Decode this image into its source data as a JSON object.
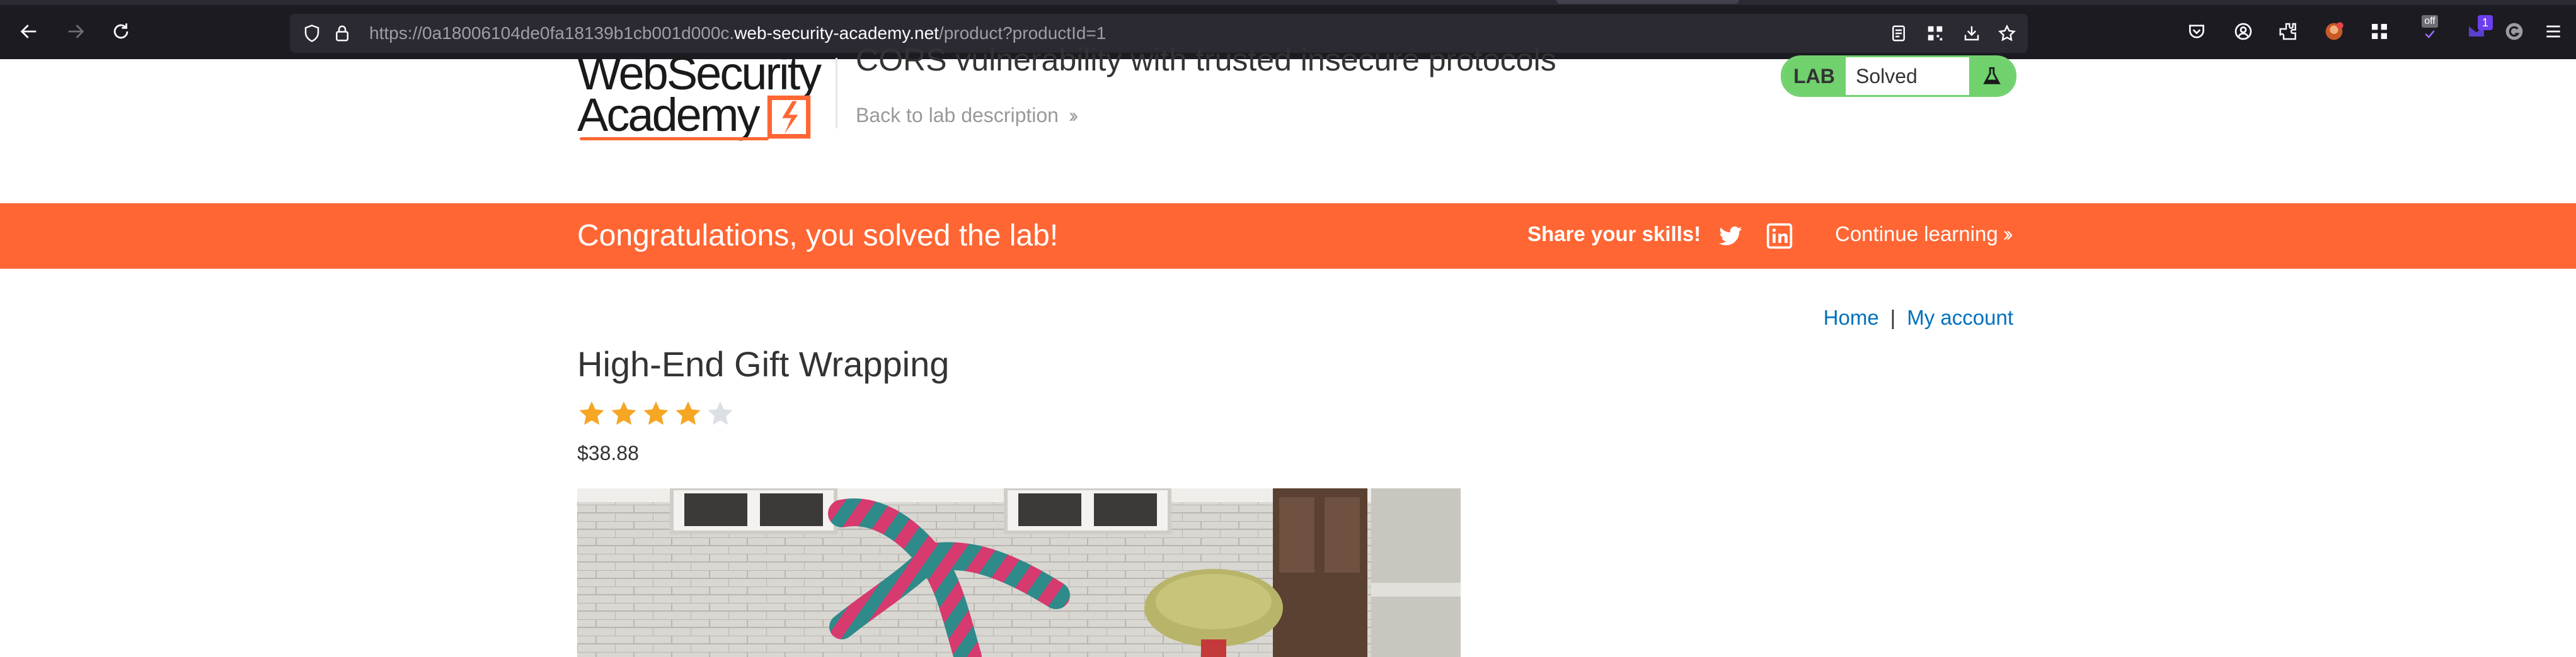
{
  "browser": {
    "url_prefix": "https://0a18006104de0fa18139b1cb001d000c.",
    "url_host": "web-security-academy.net",
    "url_path": "/product?productId=1",
    "extension_badge_off": "off",
    "extension_badge_count": "1"
  },
  "logo": {
    "line1": "WebSecurity",
    "line2": "Academy"
  },
  "header": {
    "lab_title": "CORS vulnerability with trusted insecure protocols",
    "back_link": "Back to lab description",
    "lab_badge": "LAB",
    "lab_state": "Solved"
  },
  "banner": {
    "message": "Congratulations, you solved the lab!",
    "share_label": "Share your skills!",
    "continue_label": "Continue learning"
  },
  "account_nav": {
    "home": "Home",
    "separator": "|",
    "my_account": "My account"
  },
  "product": {
    "title": "High-End Gift Wrapping",
    "rating": 4,
    "rating_max": 5,
    "price": "$38.88"
  },
  "colors": {
    "brand_orange": "#ff6633",
    "solved_green": "#70d16d",
    "link_blue": "#0071bc",
    "star_filled": "#f5a623",
    "star_empty": "#dcdfe3"
  }
}
